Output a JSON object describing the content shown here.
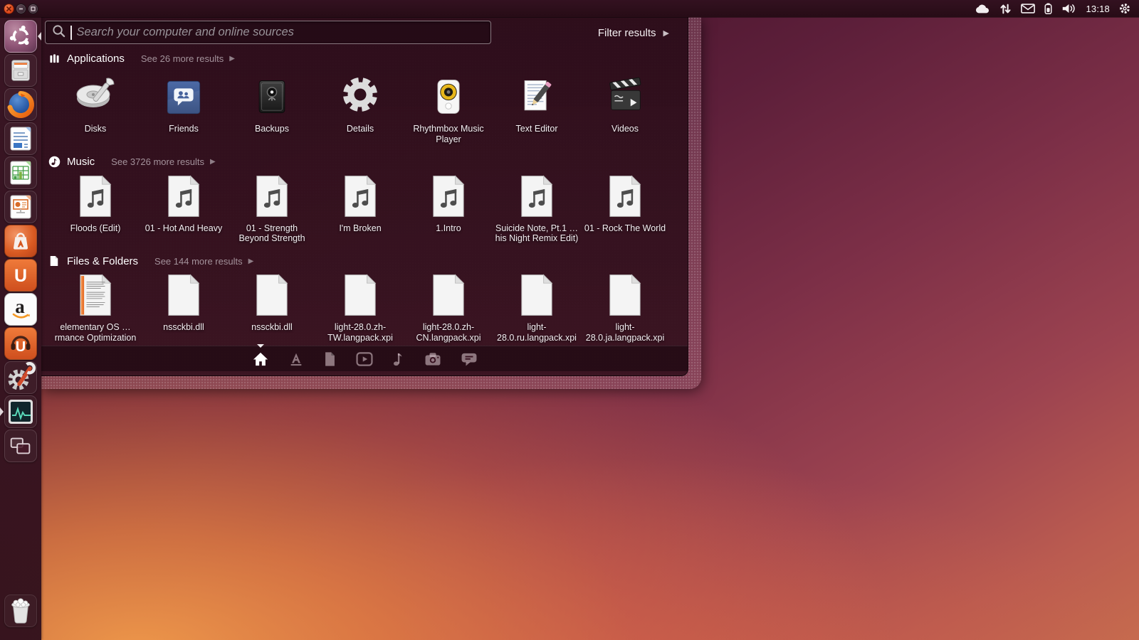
{
  "colors": {
    "accent_orange": "#dd4814",
    "panel_bg": "#2b0e19",
    "dash_bg": "#2e0d1b",
    "close_button": "#df4b32",
    "launcher_orange": "#e3642e",
    "rhythmbox_yellow": "#e7b71c",
    "monitor_teal": "#59d8b8"
  },
  "panel": {
    "time": "13:18",
    "window_controls": [
      {
        "name": "close"
      },
      {
        "name": "minimize"
      },
      {
        "name": "maximize"
      }
    ],
    "tray": [
      {
        "icon": "cloud-sync-icon"
      },
      {
        "icon": "network-arrows-icon"
      },
      {
        "icon": "mail-icon"
      },
      {
        "icon": "battery-icon"
      },
      {
        "icon": "volume-icon"
      },
      {
        "icon": "session-gear-icon"
      }
    ]
  },
  "launcher": {
    "items": [
      {
        "icon": "ubuntu-dash-icon",
        "arrow": "right"
      },
      {
        "icon": "files-manager-icon"
      },
      {
        "icon": "firefox-icon"
      },
      {
        "icon": "libreoffice-writer-icon"
      },
      {
        "icon": "libreoffice-calc-icon"
      },
      {
        "icon": "libreoffice-impress-icon"
      },
      {
        "icon": "software-center-icon"
      },
      {
        "icon": "ubuntu-one-icon"
      },
      {
        "icon": "amazon-icon"
      },
      {
        "icon": "ubuntu-one-music-icon"
      },
      {
        "icon": "system-settings-icon"
      },
      {
        "icon": "system-monitor-icon",
        "arrow": "left"
      },
      {
        "icon": "workspace-switcher-icon"
      }
    ],
    "trash_icon": "trash-icon"
  },
  "dash": {
    "search": {
      "placeholder": "Search your computer and online sources"
    },
    "filter": {
      "label": "Filter results"
    },
    "sections": [
      {
        "title": "Applications",
        "more": "See 26 more results",
        "header_icon": "applications-category-icon",
        "items": [
          {
            "label": "Disks",
            "icon": "disks-icon"
          },
          {
            "label": "Friends",
            "icon": "friends-icon"
          },
          {
            "label": "Backups",
            "icon": "backups-icon"
          },
          {
            "label": "Details",
            "icon": "details-icon"
          },
          {
            "label": "Rhythmbox Music Player",
            "icon": "rhythmbox-icon"
          },
          {
            "label": "Text Editor",
            "icon": "text-editor-icon"
          },
          {
            "label": "Videos",
            "icon": "videos-icon"
          }
        ]
      },
      {
        "title": "Music",
        "more": "See 3726 more results",
        "header_icon": "music-category-icon",
        "items": [
          {
            "label": "Floods (Edit)",
            "icon": "music-file-icon"
          },
          {
            "label": "01 - Hot And Heavy",
            "icon": "music-file-icon"
          },
          {
            "label": "01 - Strength Beyond Strength",
            "icon": "music-file-icon"
          },
          {
            "label": "I'm Broken",
            "icon": "music-file-icon"
          },
          {
            "label": "1.Intro",
            "icon": "music-file-icon"
          },
          {
            "label": "Suicide Note, Pt.1 …his Night Remix Edit)",
            "icon": "music-file-icon"
          },
          {
            "label": "01 - Rock The World",
            "icon": "music-file-icon"
          }
        ]
      },
      {
        "title": "Files & Folders",
        "more": "See 144 more results",
        "header_icon": "files-category-icon",
        "items": [
          {
            "label": "elementary OS …rmance Optimization",
            "icon": "text-document-icon"
          },
          {
            "label": "nssckbi.dll",
            "icon": "plain-document-icon"
          },
          {
            "label": "nssckbi.dll",
            "icon": "plain-document-icon"
          },
          {
            "label": "light-28.0.zh-TW.langpack.xpi",
            "icon": "plain-document-icon"
          },
          {
            "label": "light-28.0.zh-CN.langpack.xpi",
            "icon": "plain-document-icon"
          },
          {
            "label": "light-28.0.ru.langpack.xpi",
            "icon": "plain-document-icon"
          },
          {
            "label": "light-28.0.ja.langpack.xpi",
            "icon": "plain-document-icon"
          }
        ]
      }
    ],
    "lens_bar": [
      {
        "icon": "home-lens-icon",
        "active": true
      },
      {
        "icon": "applications-lens-icon",
        "active": false
      },
      {
        "icon": "files-lens-icon",
        "active": false
      },
      {
        "icon": "videos-lens-icon",
        "active": false
      },
      {
        "icon": "music-lens-icon",
        "active": false
      },
      {
        "icon": "photos-lens-icon",
        "active": false
      },
      {
        "icon": "social-lens-icon",
        "active": false
      }
    ]
  }
}
